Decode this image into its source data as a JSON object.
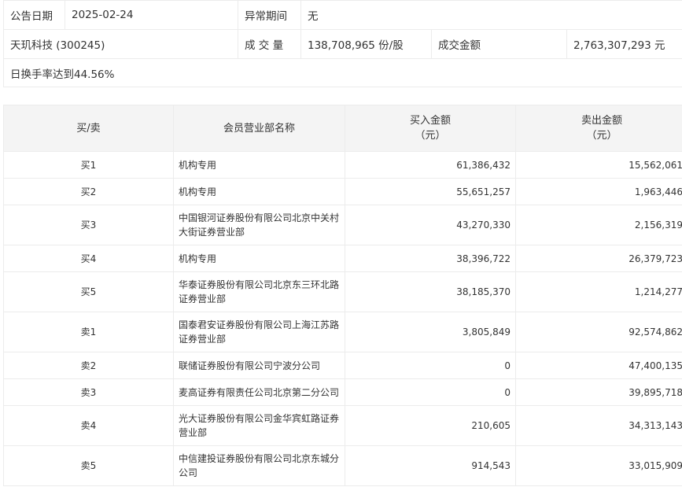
{
  "info": {
    "date_label": "公告日期",
    "date": "2025-02-24",
    "period_label": "异常期间",
    "period": "无",
    "stock": "天玑科技 (300245)",
    "volume_label": "成 交 量",
    "volume": "138,708,965 份/股",
    "amount_label": "成交金额",
    "amount": "2,763,307,293 元",
    "reason": "日换手率达到44.56%"
  },
  "table": {
    "headers": {
      "side": "买/卖",
      "name": "会员营业部名称",
      "buy": "买入金额",
      "buy_unit": "（元）",
      "sell": "卖出金额",
      "sell_unit": "（元）"
    },
    "rows": [
      {
        "side": "买1",
        "name": "机构专用",
        "buy": "61,386,432",
        "sell": "15,562,061"
      },
      {
        "side": "买2",
        "name": "机构专用",
        "buy": "55,651,257",
        "sell": "1,963,446"
      },
      {
        "side": "买3",
        "name": "中国银河证券股份有限公司北京中关村大街证券营业部",
        "buy": "43,270,330",
        "sell": "2,156,319"
      },
      {
        "side": "买4",
        "name": "机构专用",
        "buy": "38,396,722",
        "sell": "26,379,723"
      },
      {
        "side": "买5",
        "name": "华泰证券股份有限公司北京东三环北路证券营业部",
        "buy": "38,185,370",
        "sell": "1,214,277"
      },
      {
        "side": "卖1",
        "name": "国泰君安证券股份有限公司上海江苏路证券营业部",
        "buy": "3,805,849",
        "sell": "92,574,862"
      },
      {
        "side": "卖2",
        "name": "联储证券股份有限公司宁波分公司",
        "buy": "0",
        "sell": "47,400,135"
      },
      {
        "side": "卖3",
        "name": "麦高证券有限责任公司北京第二分公司",
        "buy": "0",
        "sell": "39,895,718"
      },
      {
        "side": "卖4",
        "name": "光大证券股份有限公司金华宾虹路证券营业部",
        "buy": "210,605",
        "sell": "34,313,143"
      },
      {
        "side": "卖5",
        "name": "中信建投证券股份有限公司北京东城分公司",
        "buy": "914,543",
        "sell": "33,015,909"
      }
    ]
  }
}
